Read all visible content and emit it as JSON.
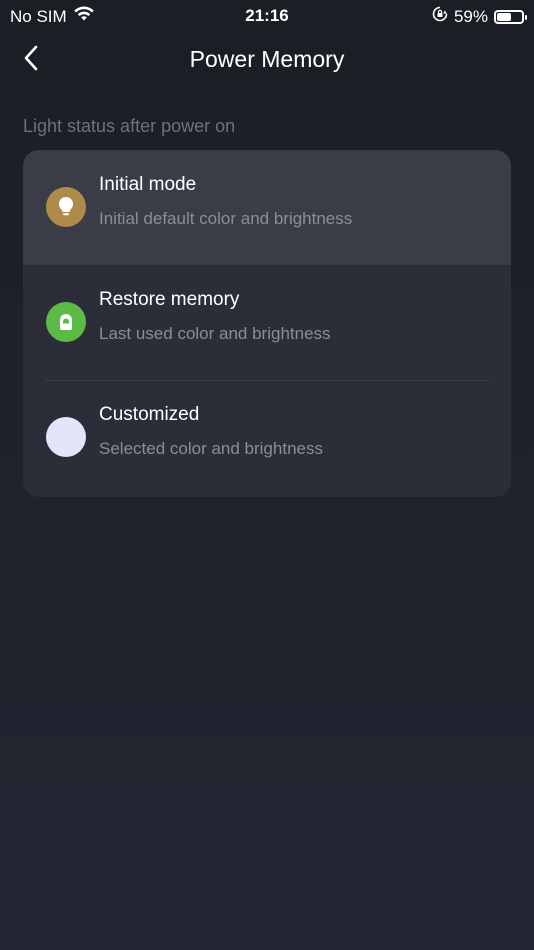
{
  "status_bar": {
    "carrier": "No SIM",
    "time": "21:16",
    "battery_percent": "59%",
    "battery_level": 0.59,
    "icons": [
      "wifi-icon",
      "orientation-lock-icon",
      "battery-icon"
    ]
  },
  "header": {
    "title": "Power Memory",
    "back_icon": "chevron-left-icon"
  },
  "section": {
    "label": "Light status after power on"
  },
  "options": [
    {
      "title": "Initial mode",
      "subtitle": "Initial default color and brightness",
      "icon": "lightbulb-icon",
      "icon_color": "#b08a48",
      "selected": true
    },
    {
      "title": "Restore memory",
      "subtitle": "Last used color and brightness",
      "icon": "memory-icon",
      "icon_color": "#5cba47",
      "selected": false
    },
    {
      "title": "Customized",
      "subtitle": "Selected color and brightness",
      "icon": "color-swatch-icon",
      "icon_color": "#e3e5fb",
      "selected": false
    }
  ],
  "colors": {
    "background": "#1f212a",
    "card": "#2b2e39",
    "selected_row": "#3a3d48",
    "muted_text": "#8a8e98"
  }
}
